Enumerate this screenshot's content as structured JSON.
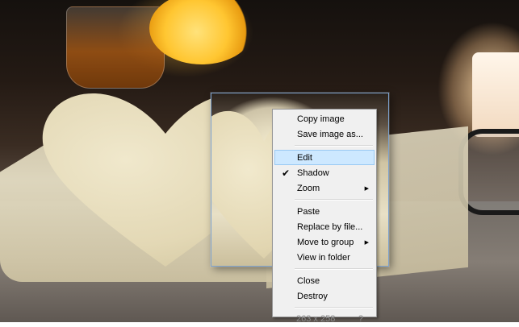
{
  "desktop": {
    "wallpaper": "open-book-heart-photo"
  },
  "snippet": {
    "border_color": "#7da2ce"
  },
  "context_menu": {
    "groups": [
      [
        {
          "label": "Copy image"
        },
        {
          "label": "Save image as..."
        }
      ],
      [
        {
          "label": "Edit",
          "highlighted": true
        },
        {
          "label": "Shadow",
          "checked": true,
          "check_icon": "checkmark-icon"
        },
        {
          "label": "Zoom",
          "submenu": true,
          "arrow_icon": "submenu-arrow-icon"
        }
      ],
      [
        {
          "label": "Paste"
        },
        {
          "label": "Replace by file..."
        },
        {
          "label": "Move to group",
          "submenu": true,
          "arrow_icon": "submenu-arrow-icon"
        },
        {
          "label": "View in folder"
        }
      ],
      [
        {
          "label": "Close"
        },
        {
          "label": "Destroy"
        }
      ]
    ],
    "footer": {
      "dimensions": "263 x 258",
      "help": "?"
    },
    "highlight_color": "#cde8ff",
    "highlight_border": "#99c9f3"
  },
  "icons": {
    "check": "✔",
    "submenu_arrow": "▶"
  }
}
